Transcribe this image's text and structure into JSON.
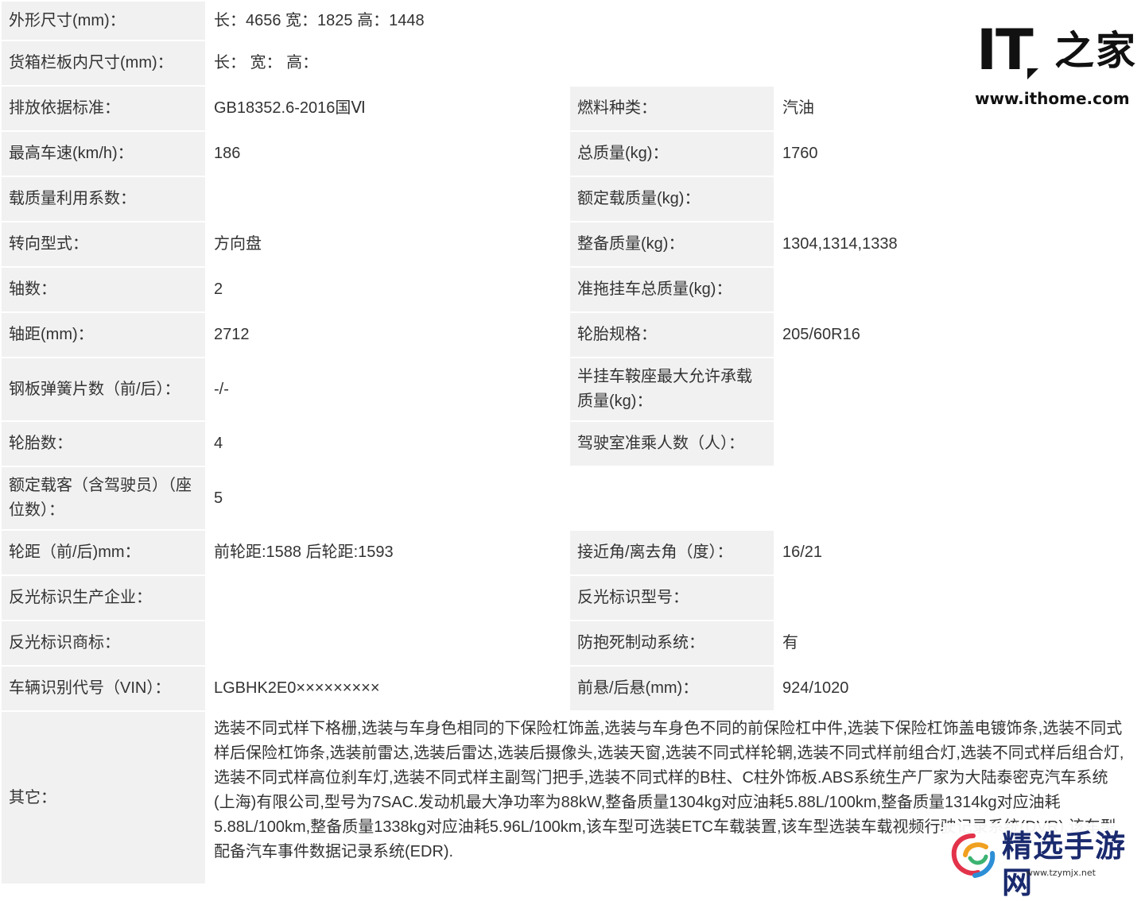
{
  "rows": [
    {
      "l1": "外形尺寸(mm)：",
      "v1": "长：4656 宽：1825 高：1448"
    },
    {
      "l1": "货箱栏板内尺寸(mm)：",
      "v1": "长：  宽：  高："
    },
    {
      "l1": "排放依据标准：",
      "v1": "GB18352.6-2016国Ⅵ",
      "l2": "燃料种类：",
      "v2": "汽油"
    },
    {
      "l1": "最高车速(km/h)：",
      "v1": "186",
      "l2": "总质量(kg)：",
      "v2": "1760"
    },
    {
      "l1": "载质量利用系数：",
      "v1": "",
      "l2": "额定载质量(kg)：",
      "v2": ""
    },
    {
      "l1": "转向型式：",
      "v1": "方向盘",
      "l2": "整备质量(kg)：",
      "v2": "1304,1314,1338"
    },
    {
      "l1": "轴数：",
      "v1": "2",
      "l2": "准拖挂车总质量(kg)：",
      "v2": ""
    },
    {
      "l1": "轴距(mm)：",
      "v1": "2712",
      "l2": "轮胎规格：",
      "v2": "205/60R16"
    },
    {
      "l1": "钢板弹簧片数（前/后）：",
      "v1": "-/-",
      "l2": "半挂车鞍座最大允许承载质量(kg)：",
      "v2": ""
    },
    {
      "l1": "轮胎数：",
      "v1": "4",
      "l2": "驾驶室准乘人数（人）：",
      "v2": ""
    },
    {
      "l1": "额定载客（含驾驶员）（座位数）：",
      "v1": "5"
    },
    {
      "l1": "轮距（前/后)mm：",
      "v1": "前轮距:1588 后轮距:1593",
      "l2": "接近角/离去角（度）：",
      "v2": "16/21"
    },
    {
      "l1": "反光标识生产企业：",
      "v1": "",
      "l2": "反光标识型号：",
      "v2": ""
    },
    {
      "l1": "反光标识商标：",
      "v1": "",
      "l2": "防抱死制动系统：",
      "v2": "有"
    },
    {
      "l1": "车辆识别代号（VIN）：",
      "v1": "LGBHK2E0×××××××××",
      "l2": "前悬/后悬(mm)：",
      "v2": "924/1020"
    },
    {
      "l1": "其它：",
      "v1": "选装不同式样下格栅,选装与车身色相同的下保险杠饰盖,选装与车身色不同的前保险杠中件,选装下保险杠饰盖电镀饰条,选装不同式样后保险杠饰条,选装前雷达,选装后雷达,选装后摄像头,选装天窗,选装不同式样轮辋,选装不同式样前组合灯,选装不同式样后组合灯,选装不同式样高位刹车灯,选装不同式样主副驾门把手,选装不同式样的B柱、C柱外饰板.ABS系统生产厂家为大陆泰密克汽车系统(上海)有限公司,型号为7SAC.发动机最大净功率为88kW,整备质量1304kg对应油耗5.88L/100km,整备质量1314kg对应油耗5.88L/100km,整备质量1338kg对应油耗5.96L/100km,该车型可选装ETC车载装置,该车型选装车载视频行驶记录系统(DVR).该车型配备汽车事件数据记录系统(EDR)."
    }
  ],
  "watermark_top": {
    "brand_it": "IT",
    "brand_cn": "之家",
    "url": "www.ithome.com"
  },
  "watermark_bottom": {
    "brand_cn": "精选手游网",
    "url": "www.tzymjx.net"
  },
  "colors": {
    "label_bg": "#f1f1f1",
    "value_bg": "#ffffff",
    "text": "#333333",
    "logo_dark": "#111111",
    "tz_blue": "#1a2a6e"
  }
}
